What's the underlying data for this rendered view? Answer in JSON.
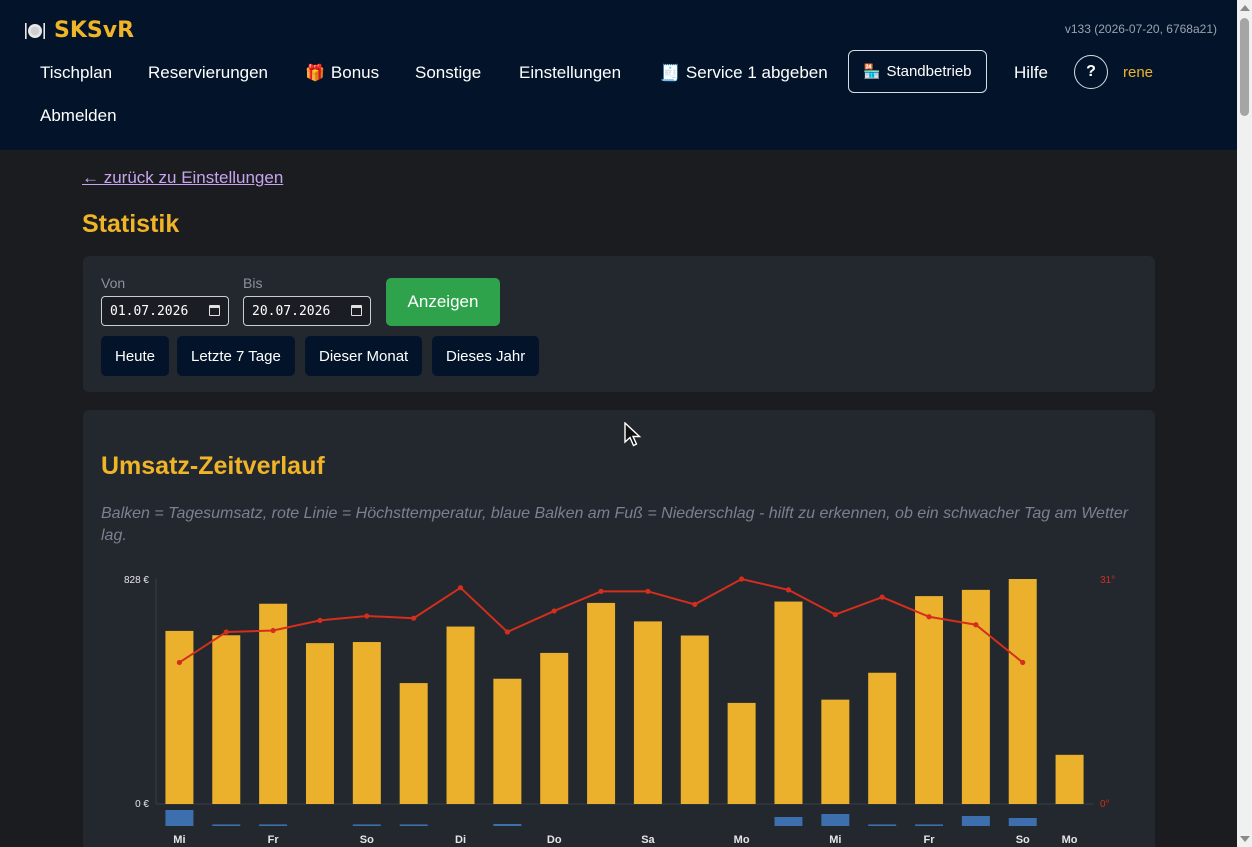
{
  "header": {
    "brand_name": "SKSvR",
    "brand_icon": "plate-cutlery-icon",
    "version": "v133 (2026-07-20, 6768a21)",
    "nav": {
      "tischplan": "Tischplan",
      "reservierungen": "Reservierungen",
      "bonus": "Bonus",
      "sonstige": "Sonstige",
      "einstellungen": "Einstellungen",
      "service": "Service 1 abgeben",
      "standbetrieb": "Standbetrieb",
      "hilfe": "Hilfe",
      "help_symbol": "?",
      "user": "rene",
      "abmelden": "Abmelden"
    }
  },
  "content": {
    "back_link": "← zurück zu Einstellungen",
    "page_title": "Statistik",
    "filter": {
      "von_label": "Von",
      "von_value": "01.07.2026",
      "bis_label": "Bis",
      "bis_value": "20.07.2026",
      "submit_label": "Anzeigen",
      "quick": [
        "Heute",
        "Letzte 7 Tage",
        "Dieser Monat",
        "Dieses Jahr"
      ]
    },
    "chart": {
      "title": "Umsatz-Zeitverlauf",
      "description": "Balken = Tagesumsatz, rote Linie = Höchsttemperatur, blaue Balken am Fuß = Niederschlag - hilft zu erkennen, ob ein schwacher Tag am Wetter lag."
    }
  },
  "colors": {
    "accent": "#f0b429",
    "header_bg": "#03142a",
    "card_bg": "#23272e",
    "revenue_bar": "#ebb12d",
    "temperature_line": "#d42e1c",
    "precipitation_bar": "#3d6fae",
    "button_green": "#2fa34b"
  },
  "chart_data": {
    "type": "bar",
    "y_left_label_max": "828 €",
    "y_left_label_min": "0 €",
    "y_right_label_max": "31°",
    "y_right_label_min": "0°",
    "ylim": [
      0,
      828
    ],
    "y2lim": [
      0,
      31
    ],
    "categories": [
      "2026-07-01",
      "2026-07-02",
      "2026-07-03",
      "2026-07-04",
      "2026-07-05",
      "2026-07-06",
      "2026-07-07",
      "2026-07-08",
      "2026-07-09",
      "2026-07-10",
      "2026-07-11",
      "2026-07-12",
      "2026-07-13",
      "2026-07-14",
      "2026-07-15",
      "2026-07-16",
      "2026-07-17",
      "2026-07-18",
      "2026-07-19",
      "2026-07-20"
    ],
    "tick_labels": [
      "Mi",
      "",
      "Fr",
      "",
      "So",
      "",
      "Di",
      "",
      "Do",
      "",
      "Sa",
      "",
      "Mo",
      "",
      "Mi",
      "",
      "Fr",
      "",
      "So",
      "Mo"
    ],
    "series": [
      {
        "kind": "revenue",
        "values": [
          637,
          621,
          737,
          592,
          596,
          445,
          653,
          461,
          556,
          740,
          672,
          620,
          372,
          745,
          384,
          483,
          765,
          788,
          828,
          181
        ]
      },
      {
        "kind": "temperature",
        "values": [
          19.5,
          23.7,
          23.9,
          25.3,
          25.9,
          25.6,
          29.8,
          23.7,
          26.6,
          29.3,
          29.3,
          27.5,
          31.0,
          29.5,
          26.1,
          28.5,
          25.8,
          24.7,
          19.5,
          null
        ]
      },
      {
        "kind": "precipitation",
        "values": [
          8,
          0.8,
          0.8,
          0,
          0.8,
          0.8,
          0,
          1,
          0,
          0,
          0,
          0,
          0,
          4.5,
          6,
          0.8,
          0.8,
          5,
          4,
          0
        ]
      }
    ]
  }
}
